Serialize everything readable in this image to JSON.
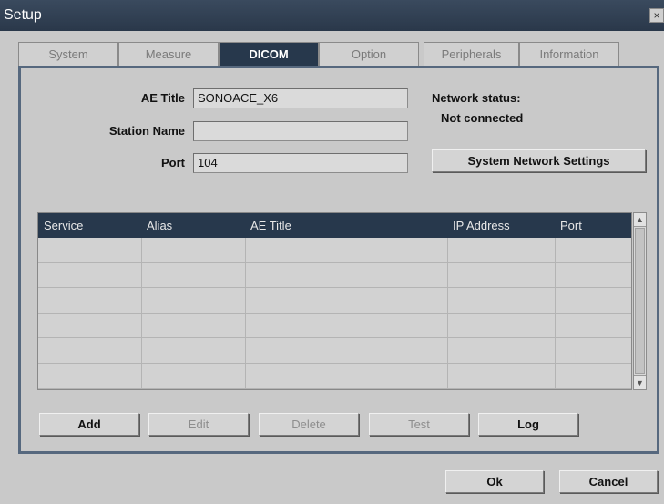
{
  "window": {
    "title": "Setup",
    "close_glyph": "×"
  },
  "tabs": [
    {
      "label": "System"
    },
    {
      "label": "Measure"
    },
    {
      "label": "DICOM"
    },
    {
      "label": "Option"
    },
    {
      "label": "Peripherals"
    },
    {
      "label": "Information"
    }
  ],
  "active_tab": "DICOM",
  "form": {
    "ae_title_label": "AE Title",
    "ae_title_value": "SONOACE_X6",
    "station_name_label": "Station Name",
    "station_name_value": "",
    "port_label": "Port",
    "port_value": "104"
  },
  "network": {
    "status_label": "Network status:",
    "status_value": "Not connected",
    "settings_button": "System Network Settings"
  },
  "table": {
    "columns": [
      "Service",
      "Alias",
      "AE Title",
      "IP Address",
      "Port"
    ],
    "rows": []
  },
  "actions": {
    "add": "Add",
    "edit": "Edit",
    "delete": "Delete",
    "test": "Test",
    "log": "Log"
  },
  "footer": {
    "ok": "Ok",
    "cancel": "Cancel"
  },
  "scrollbar": {
    "up_icon": "▲",
    "down_icon": "▼"
  },
  "colors": {
    "title_bar": "#2a384a",
    "active_tab": "#27384c",
    "panel_border": "#56687e"
  }
}
